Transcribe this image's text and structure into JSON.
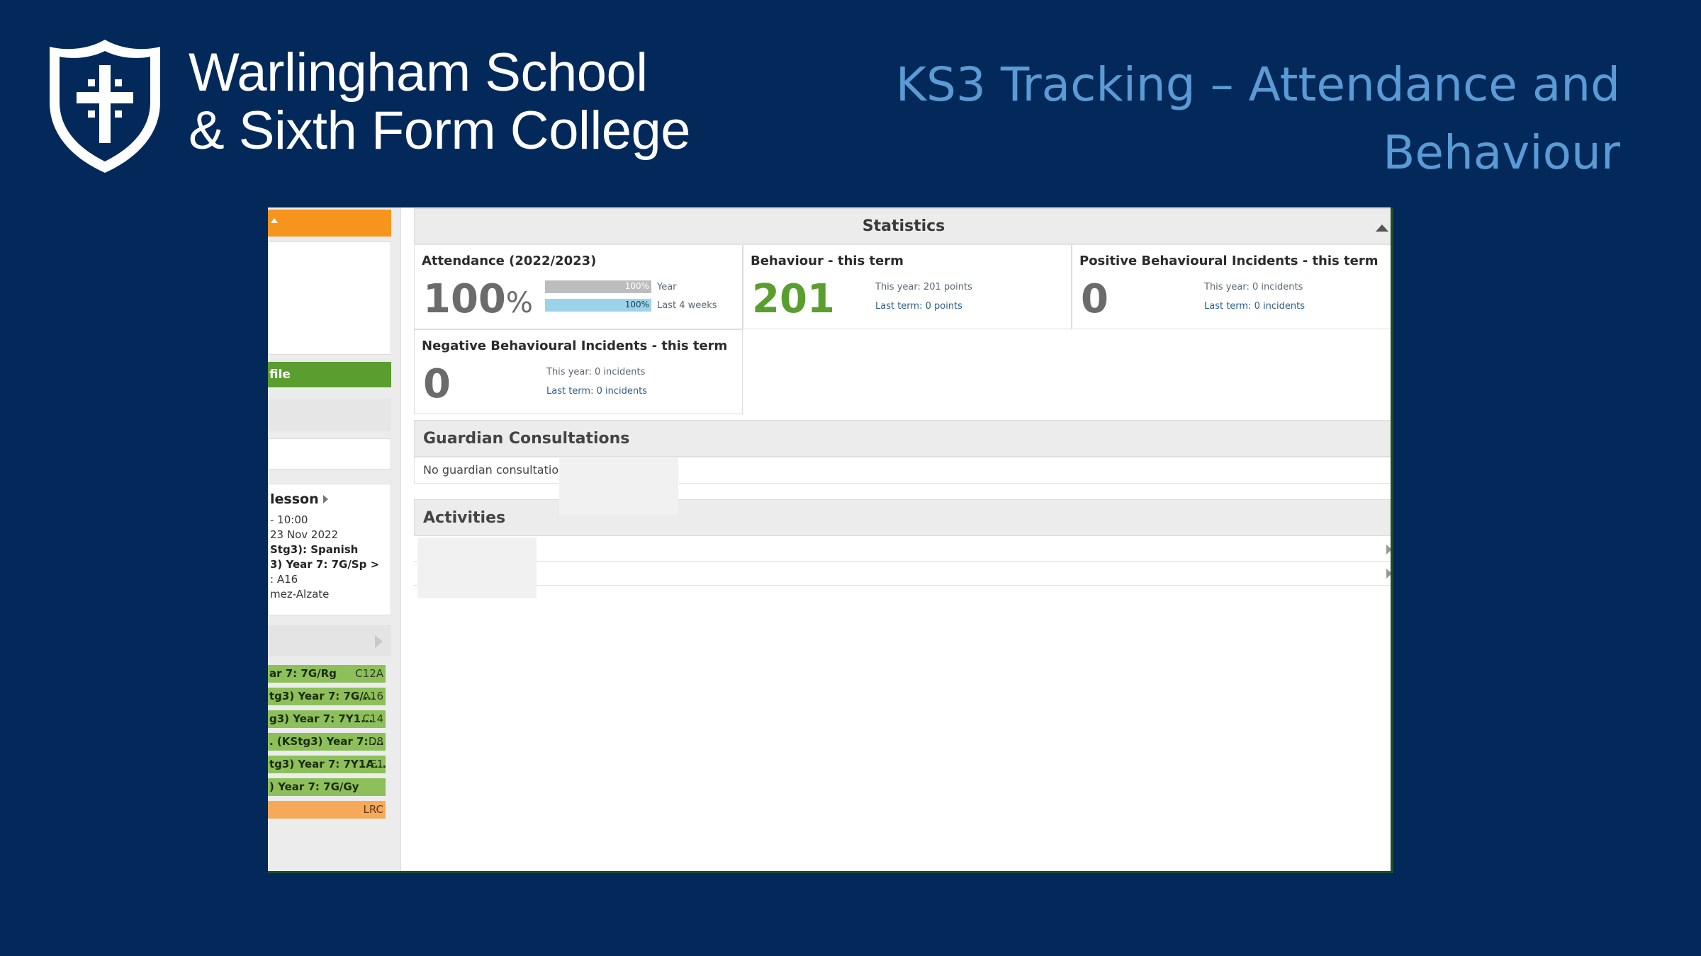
{
  "header": {
    "school_name_line1": "Warlingham School",
    "school_name_line2": "& Sixth Form College",
    "slide_title_line1": "KS3 Tracking – Attendance and",
    "slide_title_line2": "Behaviour",
    "crest_icon": "shield-cross-icon"
  },
  "colors": {
    "background": "#03295a",
    "title": "#5b9bd5",
    "accent_orange": "#f7941d",
    "accent_green": "#5a9e2f",
    "timetable_green": "#8dc05a",
    "timetable_orange": "#f7a95a",
    "attendance_bar_year": "#bdbdbd",
    "attendance_bar_4w": "#9bd3ea"
  },
  "sidebar": {
    "profile_label": "file",
    "lesson": {
      "title": "lesson",
      "lines": [
        "- 10:00",
        "23 Nov 2022",
        "Stg3): Spanish",
        "3) Year 7: 7G/Sp >",
        ": A16",
        "mez-Alzate"
      ]
    },
    "timetable": [
      {
        "subject": "ar 7: 7G/Rg",
        "room": "C12A",
        "color": "green"
      },
      {
        "subject": "tg3) Year 7: 7G/...",
        "room": "A16",
        "color": "green"
      },
      {
        "subject": "g3) Year 7: 7Y1...",
        "room": "C14",
        "color": "green"
      },
      {
        "subject": ". (KStg3) Year 7: ...",
        "room": "D8",
        "color": "green"
      },
      {
        "subject": "tg3) Year 7: 7Y1A...",
        "room": "E1",
        "color": "green"
      },
      {
        "subject": ") Year 7: 7G/Gy",
        "room": "",
        "color": "green"
      },
      {
        "subject": "",
        "room": "LRC",
        "color": "orange"
      }
    ]
  },
  "statistics": {
    "header": "Statistics",
    "attendance": {
      "title": "Attendance (2022/2023)",
      "value": "100",
      "unit": "%",
      "year_bar_value": "100%",
      "year_bar_fraction": 1.0,
      "year_label": "Year",
      "last4_bar_value": "100%",
      "last4_bar_fraction": 1.0,
      "last4_label": "Last 4 weeks"
    },
    "behaviour": {
      "title": "Behaviour - this term",
      "value": "201",
      "this_year": "This year: 201 points",
      "last_term": "Last term: 0 points"
    },
    "positive": {
      "title": "Positive Behavioural Incidents - this term",
      "value": "0",
      "this_year": "This year: 0 incidents",
      "last_term": "Last term: 0 incidents"
    },
    "negative": {
      "title": "Negative Behavioural Incidents - this term",
      "value": "0",
      "this_year": "This year: 0 incidents",
      "last_term": "Last term: 0 incidents"
    }
  },
  "guardian": {
    "header": "Guardian Consultations",
    "body": "No guardian consultations"
  },
  "activities": {
    "header": "Activities"
  }
}
